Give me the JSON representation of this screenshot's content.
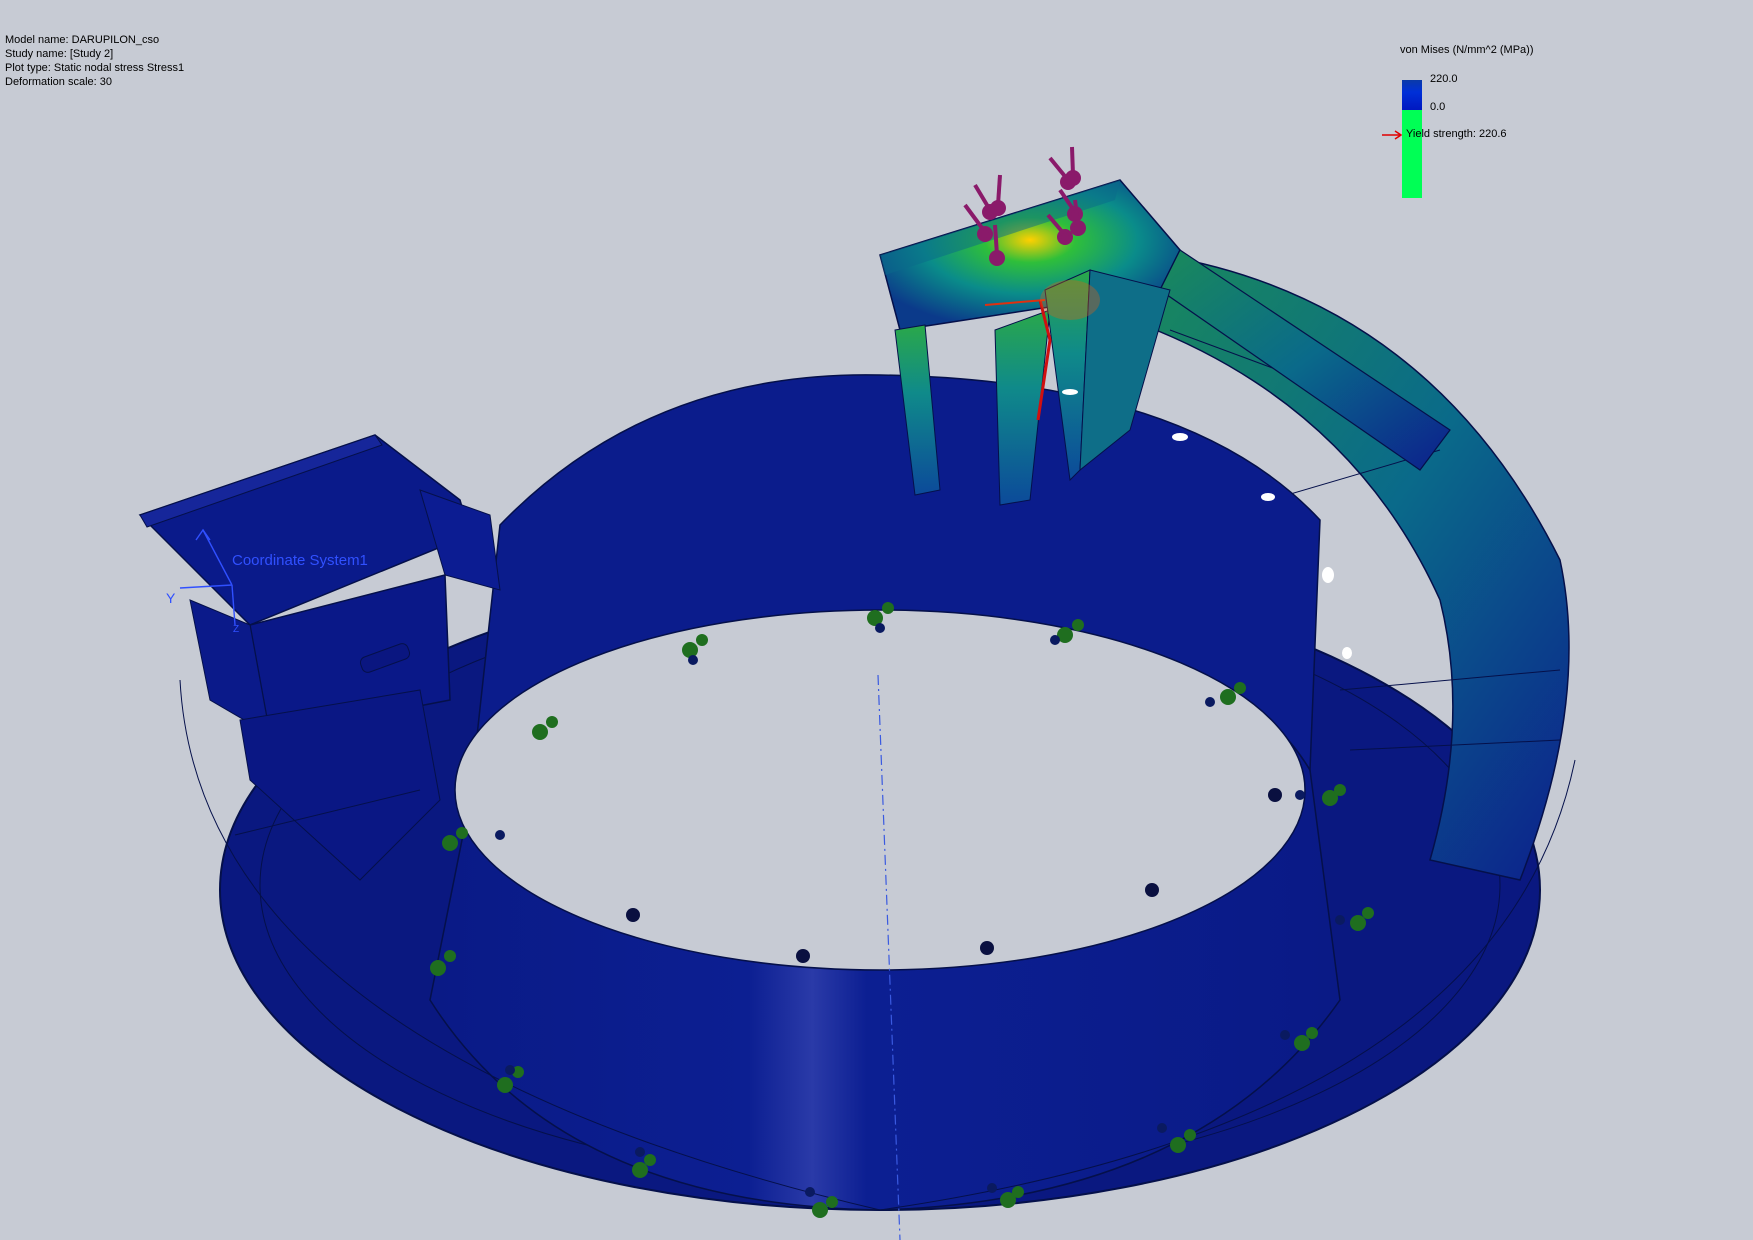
{
  "study_info": {
    "model_name": "Model name: DARUPILON_cso",
    "study_name": "Study name: [Study 2]",
    "plot_type": "Plot type: Static nodal stress Stress1",
    "deformation_scale": "Deformation scale: 30"
  },
  "legend": {
    "title": "von Mises (N/mm^2 (MPa))",
    "max_value": "220.0",
    "min_value": "0.0",
    "yield_label": "Yield strength: 220.6"
  },
  "viewport": {
    "coordinate_system_label": "Coordinate System1",
    "axis_y_label": "Y",
    "axis_z_label": "Z"
  },
  "colors": {
    "background": "#c7cbd4",
    "model_base": "#0a1a8a",
    "fixture": "#1f6e1f",
    "load_arrow": "#8a1a6a",
    "yield_arrow": "#e00000",
    "legend_high": "#0030d8",
    "legend_low": "#00ff55"
  }
}
